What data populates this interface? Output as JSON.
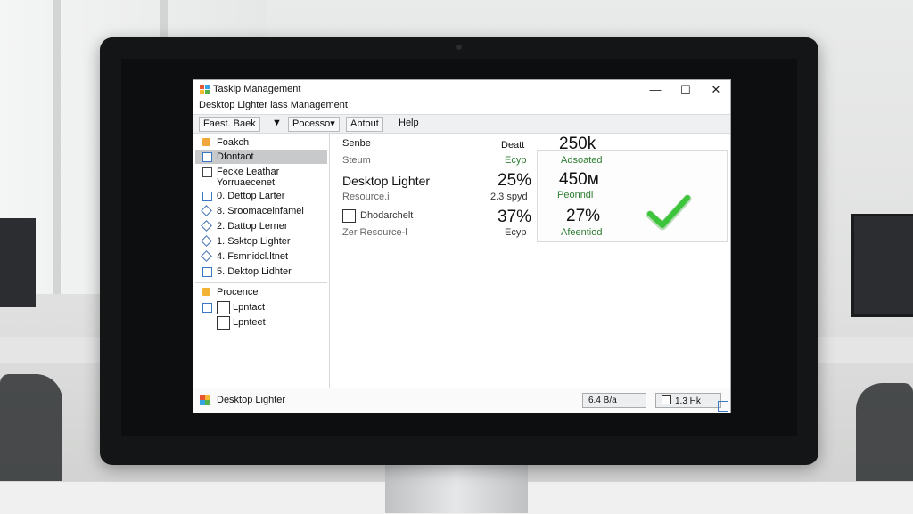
{
  "window": {
    "title": "Taskip Management",
    "subtitle": "Desktop Lighter  lass Management",
    "controls": {
      "minimize": "—",
      "maximize": "☐",
      "close": "✕"
    }
  },
  "menu": [
    "Faest. Baek",
    "▼",
    "Pocesso▾",
    "Abtout",
    "Help"
  ],
  "sidebar": {
    "items": [
      {
        "label": "Foakch",
        "icon": "folder-icon"
      },
      {
        "label": "Dfontaot",
        "icon": "list-icon",
        "selected": true
      },
      {
        "label": "Fecke Leathar",
        "icon": "checkbox-icon"
      },
      {
        "label": "Yorruaecenet",
        "icon": "none"
      },
      {
        "label": "0. Dettop Larter",
        "icon": "document-icon"
      },
      {
        "label": "8. Sroomacelnfamel",
        "icon": "diamond-icon"
      },
      {
        "label": "2. Dattop Lerner",
        "icon": "diamond-icon"
      },
      {
        "label": "1. Ssktop Lighter",
        "icon": "diamond-icon"
      },
      {
        "label": "4. Fsmnidcl.ltnet",
        "icon": "diamond-icon"
      },
      {
        "label": "5. Dektop Lidhter",
        "icon": "document-icon"
      }
    ],
    "group2": {
      "title": "Procence",
      "items": [
        {
          "label": "Lpntact"
        },
        {
          "label": "Lpnteet"
        }
      ]
    }
  },
  "main": {
    "col1": {
      "header": "Senbe",
      "row1": "Steum",
      "row2_big": "Desktop Lighter",
      "row3": "Resource.i",
      "row4": "Dhodarchelt",
      "row5": "Zer Resource-l"
    },
    "col2": {
      "header": "Deatt",
      "row1": "Ecyp",
      "row2_big": "25%",
      "row3": "2.3 spyd",
      "row4_big": "37%",
      "row5": "Ecyp"
    },
    "col3": {
      "val1_big": "250k",
      "lbl1": "Adsoated",
      "val2_big": "450м",
      "lbl2": "Peonndl",
      "val3_big": "27%",
      "lbl3": "Afeentiod"
    }
  },
  "statusbar": {
    "label": "Desktop Lighter",
    "box1": "6.4 B/a",
    "box2": "1.3 Hk"
  },
  "colors": {
    "accent_green": "#2e7d32",
    "check_green": "#3cc43a",
    "selection": "#c7c9cb"
  }
}
